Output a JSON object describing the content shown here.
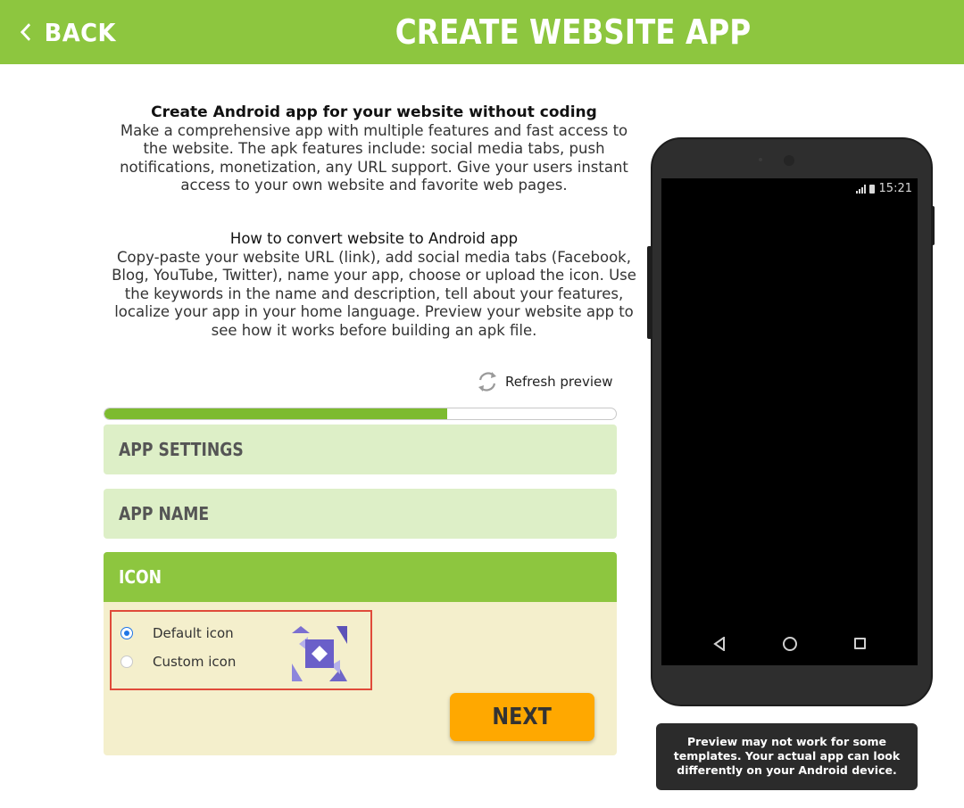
{
  "header": {
    "back_label": "BACK",
    "title": "CREATE WEBSITE APP",
    "bg_color": "#8dc63f"
  },
  "intro": {
    "heading": "Create Android app for your website without coding",
    "body": "Make a comprehensive app with multiple features and fast access to the website. The apk features include: social media tabs, push notifications, monetization, any URL support. Give your users instant access to your own website and favorite web pages.",
    "howto_heading": "How to convert website to Android app",
    "howto_body": "Copy-paste your website URL (link), add social media tabs (Facebook, Blog, YouTube, Twitter), name your app, choose or upload the icon. Use the keywords in the name and description, tell about your features, localize your app in your home language. Preview your website app to see how it works before building an apk file."
  },
  "refresh": {
    "label": "Refresh preview",
    "icon": "refresh-icon"
  },
  "progress": {
    "percent": 67,
    "fill_color": "#7dbb2f"
  },
  "sections": {
    "app_settings": "APP SETTINGS",
    "app_name": "APP NAME",
    "icon": "ICON"
  },
  "icon_options": {
    "default_label": "Default icon",
    "custom_label": "Custom icon",
    "selected": "default"
  },
  "next_button": {
    "label": "NEXT",
    "color": "#ffa800"
  },
  "phone": {
    "time": "15:21"
  },
  "tooltip": {
    "text": "Preview may not work for some templates. Your actual app can look differently on your Android device."
  }
}
